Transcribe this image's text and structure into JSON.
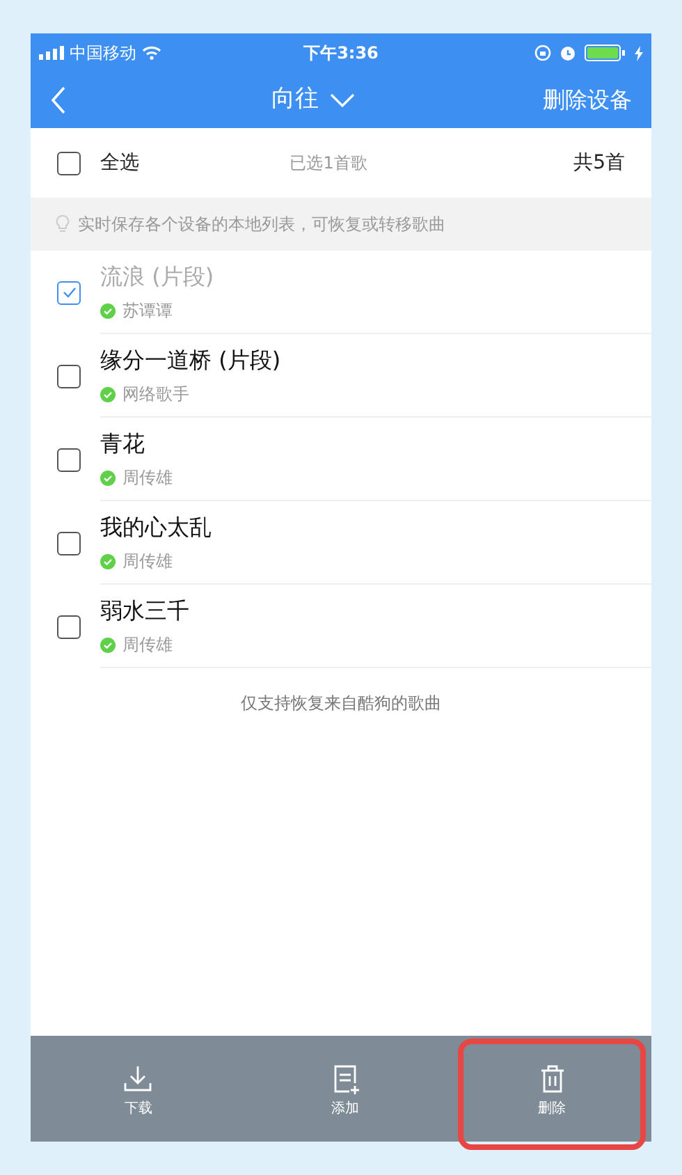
{
  "status_bar": {
    "carrier": "中国移动",
    "time": "下午3:36"
  },
  "nav": {
    "title": "向往",
    "action": "删除设备"
  },
  "select_bar": {
    "label": "全选",
    "checked": false,
    "summary": "已选1首歌",
    "total": "共5首"
  },
  "tip": "实时保存各个设备的本地列表，可恢复或转移歌曲",
  "songs": [
    {
      "title": "流浪 (片段)",
      "artist": "苏谭谭",
      "checked": true
    },
    {
      "title": "缘分一道桥 (片段)",
      "artist": "网络歌手",
      "checked": false
    },
    {
      "title": "青花",
      "artist": "周传雄",
      "checked": false
    },
    {
      "title": "我的心太乱",
      "artist": "周传雄",
      "checked": false
    },
    {
      "title": "弱水三千",
      "artist": "周传雄",
      "checked": false
    }
  ],
  "footer_note": "仅支持恢复来自酷狗的歌曲",
  "actions": [
    {
      "kind": "download",
      "label": "下载",
      "highlighted": false
    },
    {
      "kind": "add",
      "label": "添加",
      "highlighted": false
    },
    {
      "kind": "delete",
      "label": "删除",
      "highlighted": true
    }
  ]
}
